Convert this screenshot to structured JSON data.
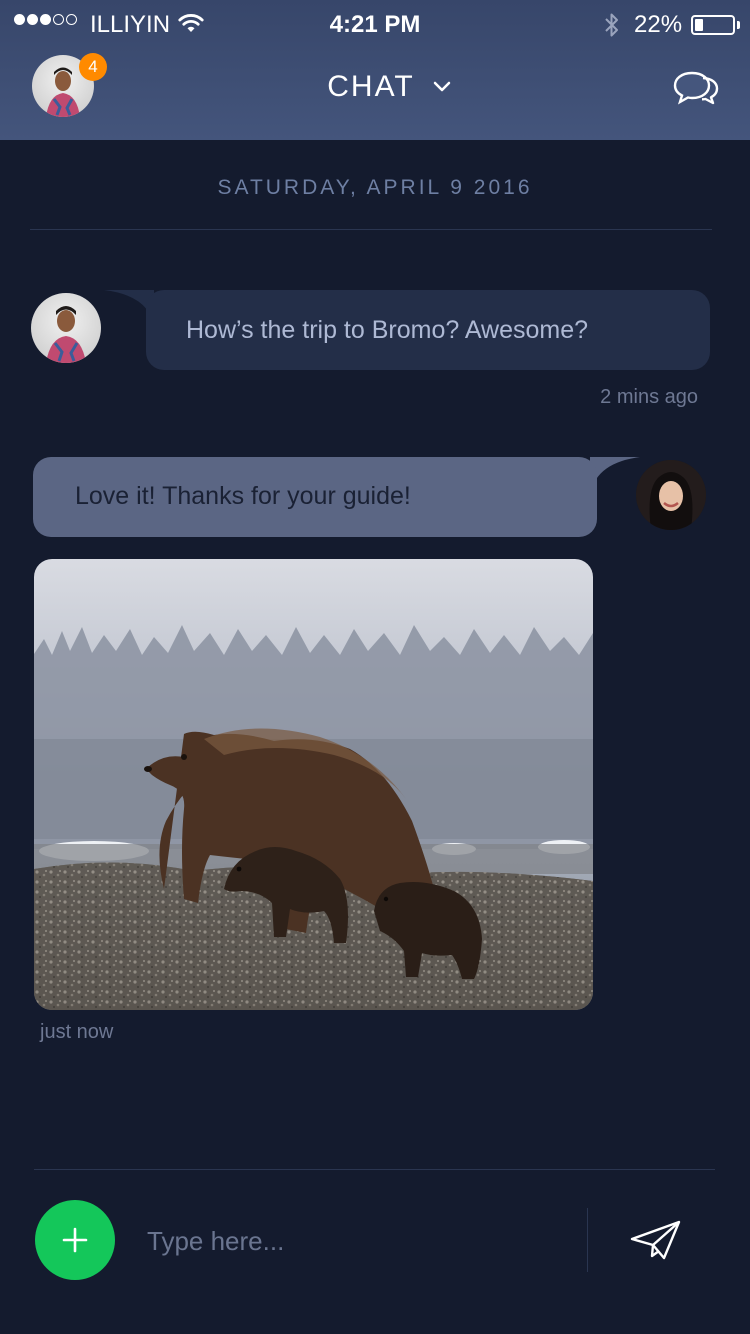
{
  "status_bar": {
    "carrier": "ILLIYIN",
    "time": "4:21 PM",
    "battery": "22%",
    "battery_level": 0.22,
    "signal_bars_filled": 3,
    "signal_bars_total": 5
  },
  "header": {
    "title": "CHAT",
    "notification_count": "4",
    "badge_color": "#ff8a00"
  },
  "conversation": {
    "date": "SATURDAY, APRIL 9 2016",
    "messages": [
      {
        "direction": "incoming",
        "text": "How’s the trip to Bromo? Awesome?",
        "time": "2 mins ago"
      },
      {
        "direction": "outgoing",
        "text": "Love it! Thanks for your guide!"
      },
      {
        "direction": "outgoing",
        "type": "image",
        "image": "bears-photo",
        "time": "just now"
      }
    ]
  },
  "composer": {
    "placeholder": "Type here...",
    "add_button_color": "#14c75a"
  },
  "icons": {
    "chat": "chat-bubbles-icon",
    "chevron": "chevron-down-icon",
    "send": "paper-plane-icon",
    "add": "plus-icon",
    "wifi": "wifi-icon",
    "bluetooth": "bluetooth-icon"
  }
}
